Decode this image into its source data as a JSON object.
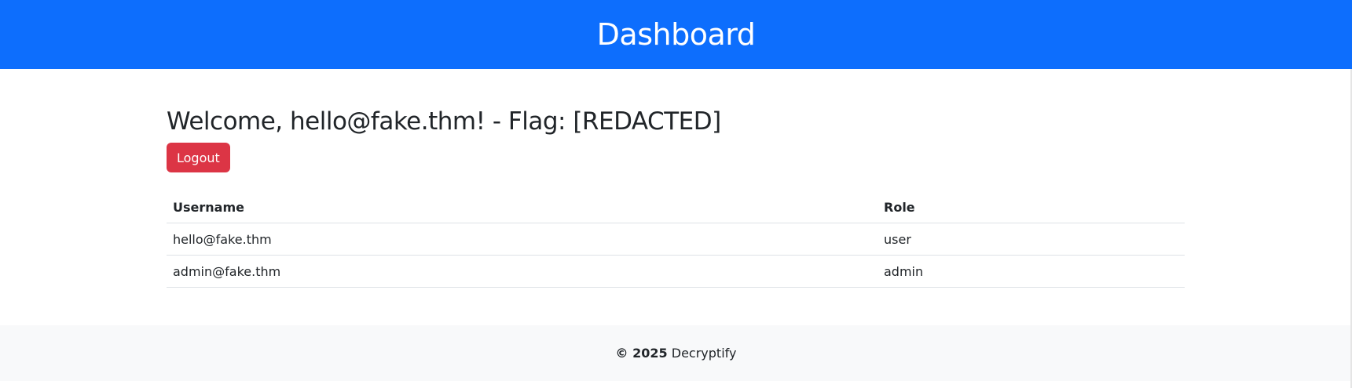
{
  "header": {
    "title": "Dashboard"
  },
  "main": {
    "welcome": "Welcome, hello@fake.thm! - Flag: [REDACTED]",
    "logout_label": "Logout",
    "table": {
      "headers": [
        "Username",
        "Role"
      ],
      "rows": [
        [
          "hello@fake.thm",
          "user"
        ],
        [
          "admin@fake.thm",
          "admin"
        ]
      ]
    }
  },
  "footer": {
    "copyright": "©",
    "year": "2025",
    "brand": "Decryptify"
  },
  "colors": {
    "primary": "#0d6efd",
    "danger": "#dc3545",
    "footer_bg": "#f8f9fa"
  }
}
